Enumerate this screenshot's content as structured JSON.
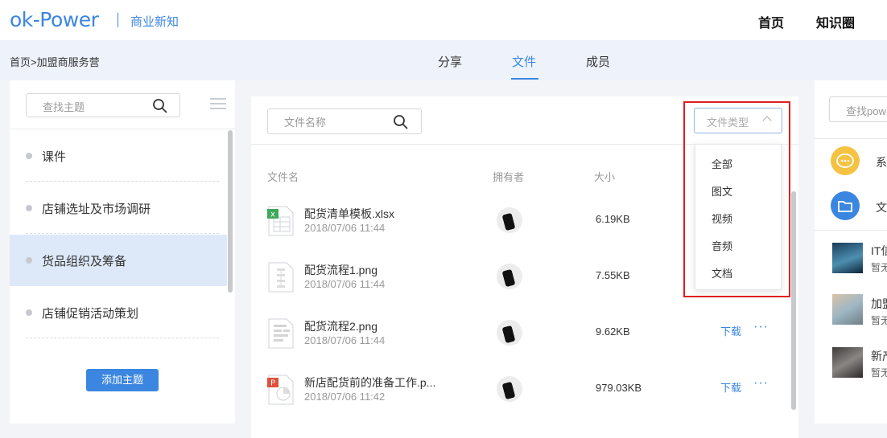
{
  "header": {
    "logo": "ok-Power",
    "subtitle": "商业新知",
    "nav": [
      "首页",
      "知识圈"
    ]
  },
  "subbar": {
    "breadcrumb": "首页>加盟商服务营",
    "tabs": [
      {
        "label": "分享",
        "active": false
      },
      {
        "label": "文件",
        "active": true
      },
      {
        "label": "成员",
        "active": false
      }
    ]
  },
  "left": {
    "search_placeholder": "查找主题",
    "topics": [
      {
        "label": "课件",
        "selected": false
      },
      {
        "label": "店铺选址及市场调研",
        "selected": false
      },
      {
        "label": "货品组织及筹备",
        "selected": true
      },
      {
        "label": "店铺促销活动策划",
        "selected": false
      }
    ],
    "add_button": "添加主题"
  },
  "center": {
    "search_placeholder": "文件名称",
    "type_placeholder": "文件类型",
    "type_options": [
      "全部",
      "图文",
      "视频",
      "音频",
      "文档"
    ],
    "columns": [
      "文件名",
      "拥有者",
      "大小"
    ],
    "files": [
      {
        "name": "配货清单模板.xlsx",
        "date": "2018/07/06 11:44",
        "size": "6.19KB",
        "icon": "excel-file-icon",
        "download": ""
      },
      {
        "name": "配货流程1.png",
        "date": "2018/07/06 11:44",
        "size": "7.55KB",
        "icon": "image-file-icon",
        "download": ""
      },
      {
        "name": "配货流程2.png",
        "date": "2018/07/06 11:44",
        "size": "9.62KB",
        "icon": "image-file-icon",
        "download": "下载"
      },
      {
        "name": "新店配货前的准备工作.p...",
        "date": "2018/07/06 11:42",
        "size": "979.03KB",
        "icon": "ppt-file-icon",
        "download": "下载"
      }
    ],
    "more": "···"
  },
  "right": {
    "search_placeholder": "查找pow",
    "items": [
      "系",
      "文"
    ],
    "articles": [
      {
        "title": "IT信",
        "sub": "暂无"
      },
      {
        "title": "加盟",
        "sub": "暂无"
      },
      {
        "title": "新产",
        "sub": "暂无"
      }
    ]
  },
  "colors": {
    "accent": "#3b86e0",
    "highlight": "#e02020",
    "selected_bg": "#dde9f8"
  }
}
